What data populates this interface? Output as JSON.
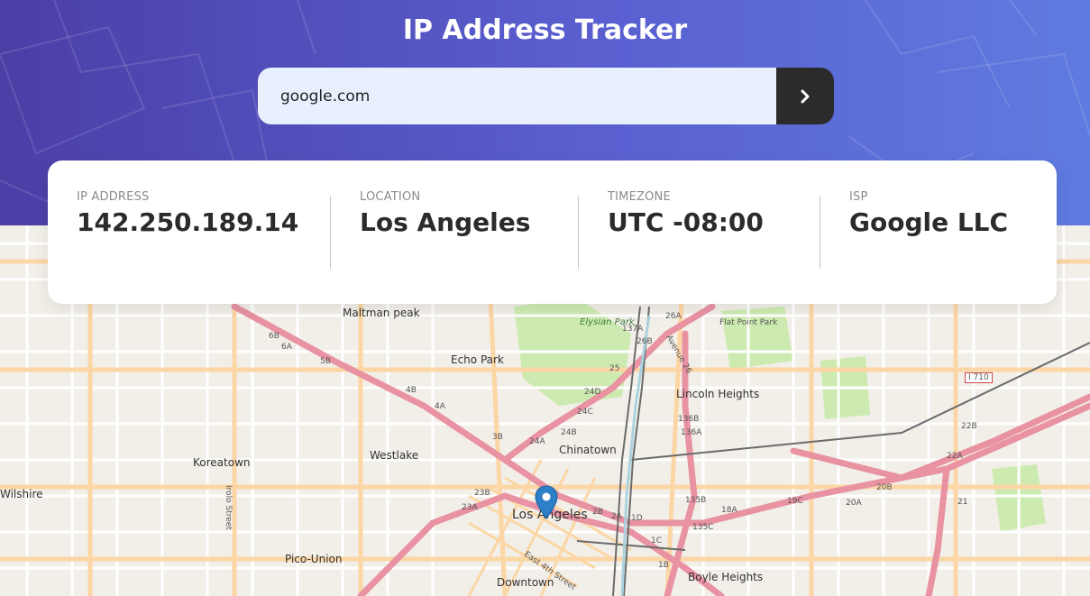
{
  "header": {
    "title": "IP Address Tracker"
  },
  "search": {
    "value": "google.com",
    "submit_icon": "chevron-right-icon"
  },
  "info": {
    "ip_label": "IP ADDRESS",
    "ip_value": "142.250.189.14",
    "location_label": "LOCATION",
    "location_value": "Los Angeles",
    "timezone_label": "TIMEZONE",
    "timezone_value": "UTC -08:00",
    "isp_label": "ISP",
    "isp_value": "Google LLC"
  },
  "map": {
    "places": [
      "Maltman peak",
      "Echo Park",
      "Elysian Park",
      "Flat Point Park",
      "Lincoln Heights",
      "Koreatown",
      "Westlake",
      "Chinatown",
      "Los Angeles",
      "Wilshire",
      "Pico-Union",
      "Downtown",
      "Boyle Heights",
      "I 710"
    ],
    "road_shields": [
      "6B",
      "6A",
      "5B",
      "4B",
      "4A",
      "3B",
      "24A",
      "24B",
      "24C",
      "24D",
      "2A",
      "1D",
      "1C",
      "1B",
      "135B",
      "135C",
      "136A",
      "136B",
      "137A",
      "26A",
      "26B",
      "18A",
      "19C",
      "20A",
      "20B",
      "21",
      "22A",
      "22B",
      "23A",
      "23B",
      "25",
      "2B"
    ],
    "streets": [
      "Irolo Street",
      "East 4th Street",
      "Avenue 26"
    ],
    "colors": {
      "major_road": "#e892a2",
      "secondary_road": "#fcd6a4",
      "park": "#cdebb0",
      "rail": "#6b6b6b"
    }
  }
}
